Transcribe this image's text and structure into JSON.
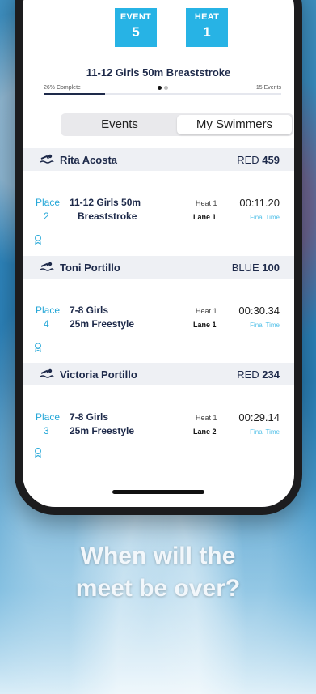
{
  "status": {
    "event_label": "EVENT",
    "event_value": "5",
    "heat_label": "HEAT",
    "heat_value": "1"
  },
  "event_title": "11-12 Girls 50m Breaststroke",
  "progress": {
    "complete_text": "26% Complete",
    "percent": 26,
    "total_text": "15 Events"
  },
  "tabs": {
    "events": "Events",
    "my_swimmers": "My Swimmers"
  },
  "swimmers": [
    {
      "name": "Rita Acosta",
      "team": "RED",
      "number": "459",
      "place_label": "Place",
      "place": "2",
      "event_line1": "11-12 Girls 50m",
      "event_line2": "Breaststroke",
      "heat": "Heat 1",
      "lane": "Lane 1",
      "time": "00:11.20",
      "time_label": "Final Time"
    },
    {
      "name": "Toni Portillo",
      "team": "BLUE",
      "number": "100",
      "place_label": "Place",
      "place": "4",
      "event_line1": "7-8 Girls",
      "event_line2": "25m Freestyle",
      "heat": "Heat 1",
      "lane": "Lane 1",
      "time": "00:30.34",
      "time_label": "Final Time"
    },
    {
      "name": "Victoria Portillo",
      "team": "RED",
      "number": "234",
      "place_label": "Place",
      "place": "3",
      "event_line1": "7-8 Girls",
      "event_line2": "25m Freestyle",
      "heat": "Heat 1",
      "lane": "Lane 2",
      "time": "00:29.14",
      "time_label": "Final Time"
    }
  ],
  "icons": {
    "swimmer": "swimmer-icon",
    "medal": "medal-icon"
  },
  "tagline": {
    "line1": "When will the",
    "line2": "meet be over?"
  },
  "colors": {
    "accent": "#27b3e5",
    "navy": "#1e2a4a"
  }
}
